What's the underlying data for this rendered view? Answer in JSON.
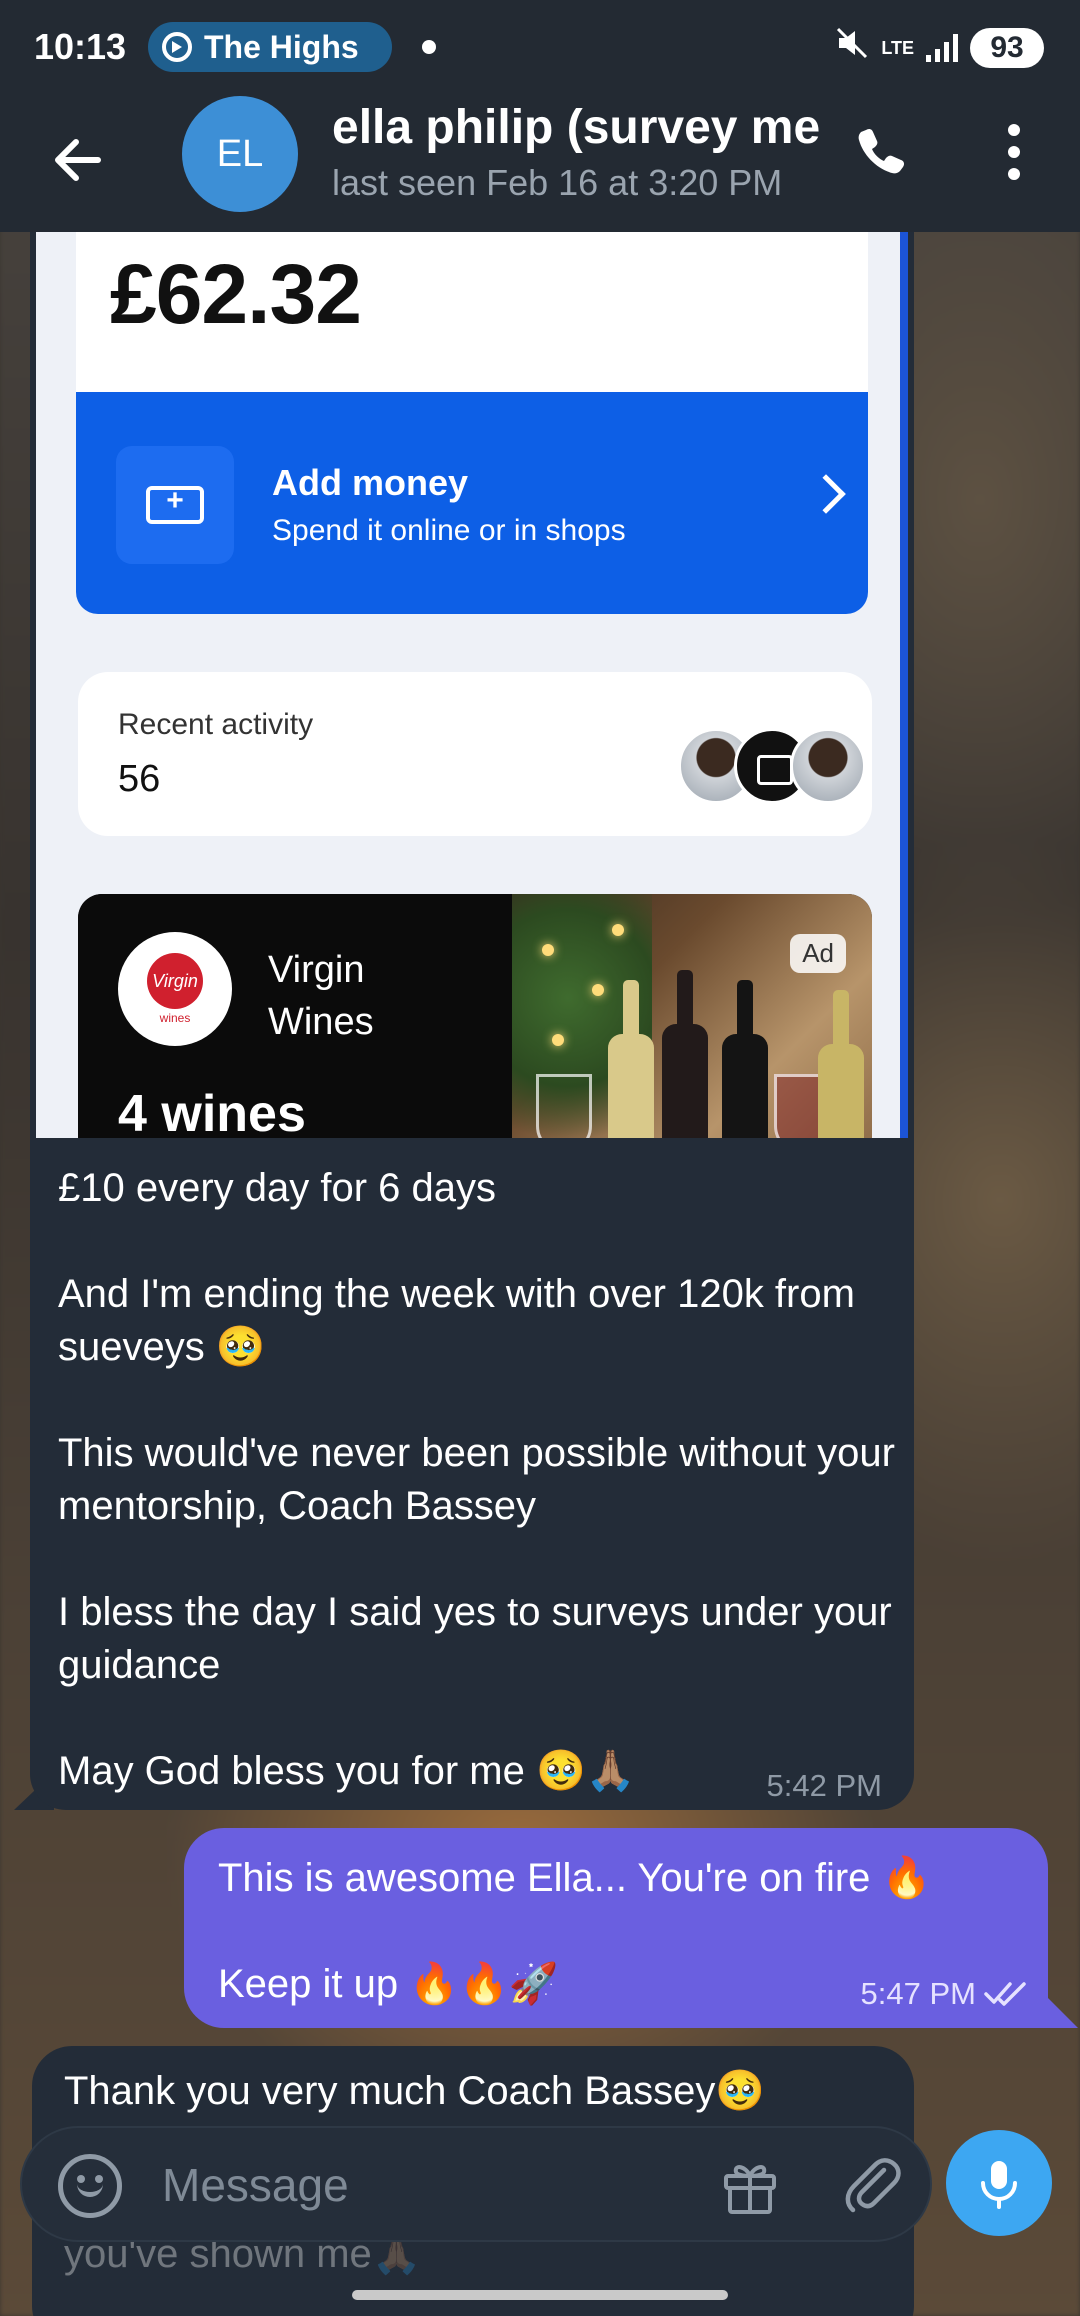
{
  "status_bar": {
    "time": "10:13",
    "notification_text": "The Highs",
    "network": "LTE",
    "battery": "93"
  },
  "header": {
    "avatar_initials": "EL",
    "name": "ella philip (survey me",
    "status": "last seen Feb 16 at 3:20 PM"
  },
  "screenshot": {
    "balance": "£62.32",
    "add_money_title": "Add money",
    "add_money_sub": "Spend it online or in shops",
    "recent_label": "Recent activity",
    "recent_value": "56",
    "ad_brand": "Virgin Wines",
    "ad_logo_text": "Virgin",
    "ad_logo_sub": "wines",
    "ad_headline": "4 wines",
    "ad_badge": "Ad"
  },
  "messages": {
    "incoming_1": {
      "text": "£10 every day for 6 days\n\nAnd I'm ending the week with over 120k from sueveys 🥹\n\nThis would've never been possible without your mentorship, Coach Bassey\n\nI bless the day I said yes to surveys under your guidance\n\nMay God bless you for me 🥹🙏🏽",
      "time": "5:42 PM"
    },
    "outgoing_1": {
      "text": "This is awesome Ella... You're on fire 🔥\n\nKeep it up 🔥🔥🚀",
      "time": "5:47 PM"
    },
    "incoming_2": {
      "text": "Thank you very much Coach Bassey🥹",
      "text_below": "you've shown me🙏🏽"
    }
  },
  "composer": {
    "placeholder": "Message"
  },
  "colors": {
    "header_bg": "#232a33",
    "incoming_bubble": "#232c38",
    "outgoing_bubble": "#6a5fe0",
    "mic_button": "#3da7f2",
    "avatar": "#3d8fd6"
  }
}
